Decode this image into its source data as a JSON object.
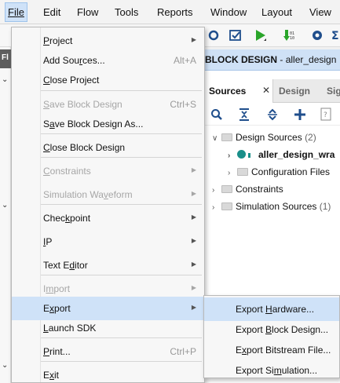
{
  "menubar": {
    "items": [
      "File",
      "Edit",
      "Flow",
      "Tools",
      "Reports",
      "Window",
      "Layout",
      "View"
    ]
  },
  "left_strip": {
    "label": "Fl"
  },
  "block_design": {
    "prefix": "BLOCK DESIGN",
    "sep": " - ",
    "name": "aller_design"
  },
  "sources_panel": {
    "tabs": [
      "Sources",
      "Design",
      "Sig"
    ],
    "tree": [
      {
        "label": "Design Sources",
        "count": "(2)"
      },
      {
        "label": "aller_design_wra"
      },
      {
        "label": "Configuration Files"
      },
      {
        "label": "Constraints"
      },
      {
        "label": "Simulation Sources",
        "count": "(1)"
      }
    ]
  },
  "file_menu": {
    "items": [
      {
        "pre": "",
        "u": "P",
        "post": "roject",
        "shortcut": "",
        "submenu": true,
        "enabled": true
      },
      {
        "pre": "Add Sou",
        "u": "r",
        "post": "ces...",
        "shortcut": "Alt+A",
        "submenu": false,
        "enabled": true
      },
      {
        "pre": "",
        "u": "C",
        "post": "lose Project",
        "shortcut": "",
        "submenu": false,
        "enabled": true
      },
      {
        "pre": "",
        "u": "S",
        "post": "ave Block Design",
        "shortcut": "Ctrl+S",
        "submenu": false,
        "enabled": false
      },
      {
        "pre": "S",
        "u": "a",
        "post": "ve Block Design As...",
        "shortcut": "",
        "submenu": false,
        "enabled": true
      },
      {
        "pre": "",
        "u": "C",
        "post": "lose Block Design",
        "shortcut": "",
        "submenu": false,
        "enabled": true
      },
      {
        "pre": "",
        "u": "C",
        "post": "onstraints",
        "shortcut": "",
        "submenu": true,
        "enabled": false
      },
      {
        "pre": "Simulation Wa",
        "u": "v",
        "post": "eform",
        "shortcut": "",
        "submenu": true,
        "enabled": false
      },
      {
        "pre": "Chec",
        "u": "k",
        "post": "point",
        "shortcut": "",
        "submenu": true,
        "enabled": true
      },
      {
        "pre": "",
        "u": "I",
        "post": "P",
        "shortcut": "",
        "submenu": true,
        "enabled": true
      },
      {
        "pre": "Text E",
        "u": "d",
        "post": "itor",
        "shortcut": "",
        "submenu": true,
        "enabled": true
      },
      {
        "pre": "I",
        "u": "m",
        "post": "port",
        "shortcut": "",
        "submenu": true,
        "enabled": false
      },
      {
        "pre": "E",
        "u": "x",
        "post": "port",
        "shortcut": "",
        "submenu": true,
        "enabled": true,
        "highlighted": true
      },
      {
        "pre": "",
        "u": "L",
        "post": "aunch SDK",
        "shortcut": "",
        "submenu": false,
        "enabled": true
      },
      {
        "pre": "",
        "u": "P",
        "post": "rint...",
        "shortcut": "Ctrl+P",
        "submenu": false,
        "enabled": true
      },
      {
        "pre": "E",
        "u": "x",
        "post": "it",
        "shortcut": "",
        "submenu": false,
        "enabled": true
      }
    ]
  },
  "export_submenu": {
    "items": [
      {
        "pre": "Export ",
        "u": "H",
        "post": "ardware...",
        "highlighted": true
      },
      {
        "pre": "Export ",
        "u": "B",
        "post": "lock Design...",
        "highlighted": false
      },
      {
        "pre": "E",
        "u": "x",
        "post": "port Bitstream File...",
        "highlighted": false
      },
      {
        "pre": "Export Si",
        "u": "m",
        "post": "ulation...",
        "highlighted": false
      }
    ]
  },
  "colors": {
    "menu_highlight": "#cfe2f8",
    "run_green": "#2aa52a",
    "header_blue": "#cfe1f6"
  }
}
